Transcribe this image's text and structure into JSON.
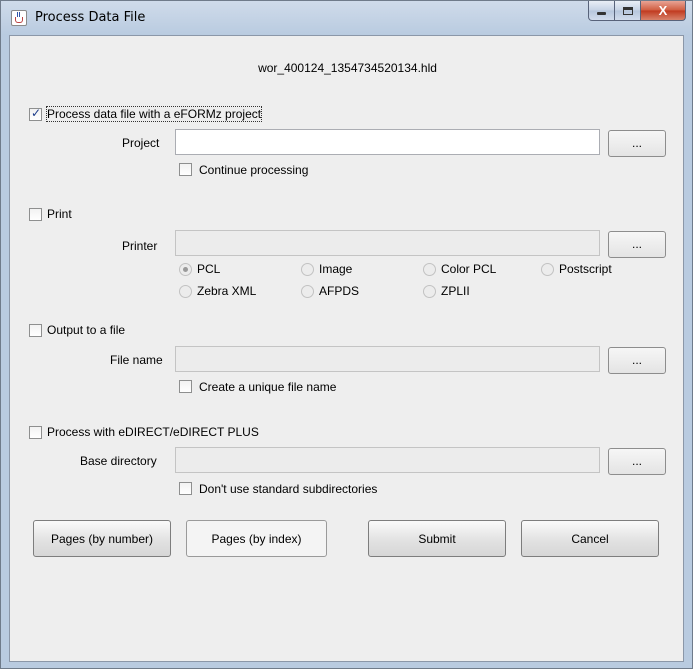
{
  "window": {
    "title": "Process Data File",
    "controls": {
      "minimize": "minimize",
      "maximize": "maximize",
      "close": "X"
    }
  },
  "filename": "wor_400124_1354734520134.hld",
  "project_section": {
    "checkbox_label": "Process data file with a eFORMz project",
    "checked": true,
    "project_label": "Project",
    "project_value": "",
    "browse_label": "...",
    "continue_label": "Continue processing",
    "continue_checked": false
  },
  "print_section": {
    "checkbox_label": "Print",
    "checked": false,
    "printer_label": "Printer",
    "printer_value": "",
    "browse_label": "...",
    "formats": [
      {
        "label": "PCL",
        "selected": true
      },
      {
        "label": "Image",
        "selected": false
      },
      {
        "label": "Color PCL",
        "selected": false
      },
      {
        "label": "Postscript",
        "selected": false
      },
      {
        "label": "Zebra XML",
        "selected": false
      },
      {
        "label": "AFPDS",
        "selected": false
      },
      {
        "label": "ZPLII",
        "selected": false
      }
    ]
  },
  "output_section": {
    "checkbox_label": "Output to a file",
    "checked": false,
    "filename_label": "File name",
    "filename_value": "",
    "browse_label": "...",
    "unique_label": "Create a unique file name",
    "unique_checked": false
  },
  "edirect_section": {
    "checkbox_label": "Process with eDIRECT/eDIRECT PLUS",
    "checked": false,
    "base_dir_label": "Base directory",
    "base_dir_value": "",
    "browse_label": "...",
    "nostd_label": "Don't use standard subdirectories",
    "nostd_checked": false
  },
  "buttons": {
    "pages_by_number": "Pages (by number)",
    "pages_by_index": "Pages (by index)",
    "submit": "Submit",
    "cancel": "Cancel"
  },
  "colors": {
    "title_gradient_top": "#cfdbea",
    "client_bg": "#eeeeee",
    "close_red": "#c0391e",
    "check_blue": "#1c3c8a"
  }
}
